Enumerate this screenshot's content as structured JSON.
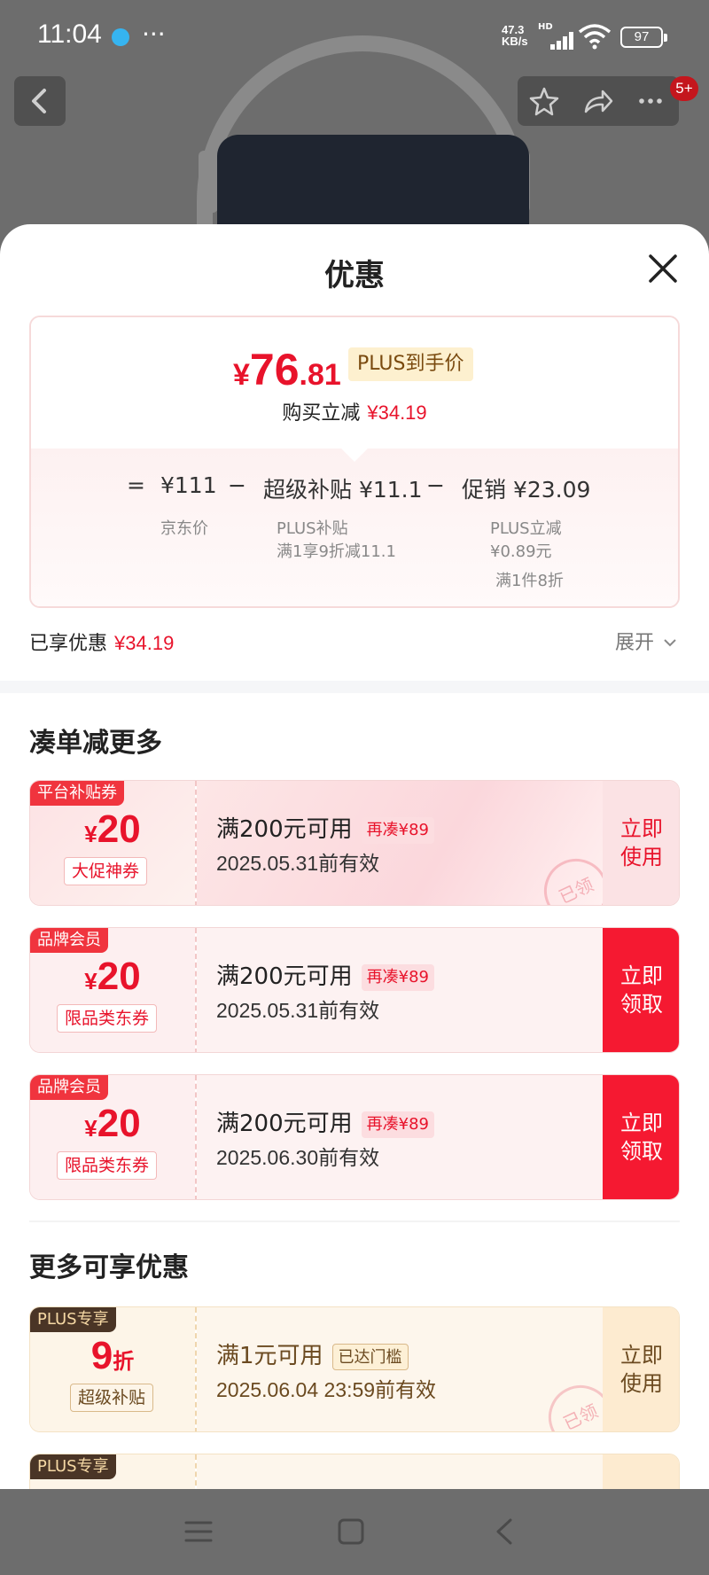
{
  "status_bar": {
    "time": "11:04",
    "more": "···",
    "net_speed_value": "47.3",
    "net_speed_unit": "KB/s",
    "network_type": "HD",
    "battery": "97"
  },
  "product_nav": {
    "back_icon": "chevron-left-icon",
    "favorite_icon": "star-icon",
    "share_icon": "share-icon",
    "more_icon": "more-icon",
    "message_badge": "5+"
  },
  "sheet": {
    "title": "优惠",
    "close_icon": "close-icon"
  },
  "price_summary": {
    "final_price_symbol": "¥",
    "final_price_int": "76",
    "final_price_dec": ".81",
    "plus_tag": "PLUS到手价",
    "reduce_label": "购买立减",
    "reduce_amount": "¥34.19",
    "formula": {
      "equals": "=",
      "minus": "−",
      "base_price": "¥111",
      "base_label": "京东价",
      "subsidy": "超级补贴 ¥11.1",
      "subsidy_label": "PLUS补贴",
      "subsidy_note": "满1享9折减11.1",
      "promo": "促销 ¥23.09",
      "promo_label": "PLUS立减",
      "promo_amount": "¥0.89元",
      "promo_note": "满1件8折"
    }
  },
  "enjoyed": {
    "label": "已享优惠",
    "amount": "¥34.19",
    "expand_label": "展开"
  },
  "section_bundle": {
    "title": "凑单减更多",
    "coupons": [
      {
        "tag": "平台补贴券",
        "symbol": "¥",
        "amount": "20",
        "kind": "大促神券",
        "condition": "满200元可用",
        "more": "再凑¥89",
        "valid": "2025.05.31前有效",
        "action_line1": "立即",
        "action_line2": "使用",
        "stamp": "已领"
      },
      {
        "tag": "品牌会员",
        "symbol": "¥",
        "amount": "20",
        "kind": "限品类东券",
        "condition": "满200元可用",
        "more": "再凑¥89",
        "valid": "2025.05.31前有效",
        "action_line1": "立即",
        "action_line2": "领取"
      },
      {
        "tag": "品牌会员",
        "symbol": "¥",
        "amount": "20",
        "kind": "限品类东券",
        "condition": "满200元可用",
        "more": "再凑¥89",
        "valid": "2025.06.30前有效",
        "action_line1": "立即",
        "action_line2": "领取"
      }
    ]
  },
  "section_more": {
    "title": "更多可享优惠",
    "coupons": [
      {
        "tag": "PLUS专享",
        "amount": "9",
        "unit": "折",
        "kind": "超级补贴",
        "condition": "满1元可用",
        "more": "已达门槛",
        "valid": "2025.06.04 23:59前有效",
        "action_line1": "立即",
        "action_line2": "使用",
        "stamp": "已领"
      },
      {
        "tag": "PLUS专享"
      }
    ]
  },
  "system_nav": {
    "menu_icon": "menu-icon",
    "home_icon": "home-square-icon",
    "back_icon": "back-triangle-icon"
  },
  "colors": {
    "accent_red": "#e8132b",
    "button_red": "#f51931",
    "plus_gold": "#6b4a20"
  }
}
